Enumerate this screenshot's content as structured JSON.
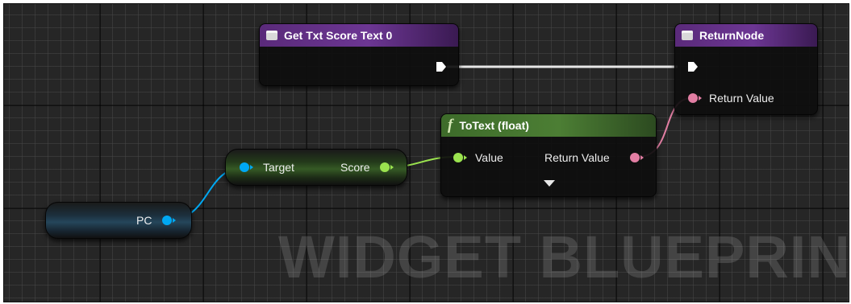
{
  "graph": {
    "watermark": "WIDGET BLUEPRINT",
    "nodes": {
      "get_score_text": {
        "title": "Get Txt Score Text 0",
        "icon": "function-icon",
        "color": "#6c3693"
      },
      "return_node": {
        "title": "ReturnNode",
        "icon": "function-icon",
        "return_value_label": "Return Value",
        "color": "#6c3693"
      },
      "to_text": {
        "title": "ToText (float)",
        "icon": "f",
        "value_label": "Value",
        "return_value_label": "Return Value",
        "expand_icon": "triangle-down-icon",
        "color": "#4c7e34"
      },
      "score_getter": {
        "target_label": "Target",
        "score_label": "Score"
      },
      "pc_getter": {
        "pc_label": "PC"
      }
    },
    "pin_colors": {
      "object": "#00a8f2",
      "float": "#9be34f",
      "text": "#e27ea3",
      "exec": "#ffffff"
    }
  }
}
